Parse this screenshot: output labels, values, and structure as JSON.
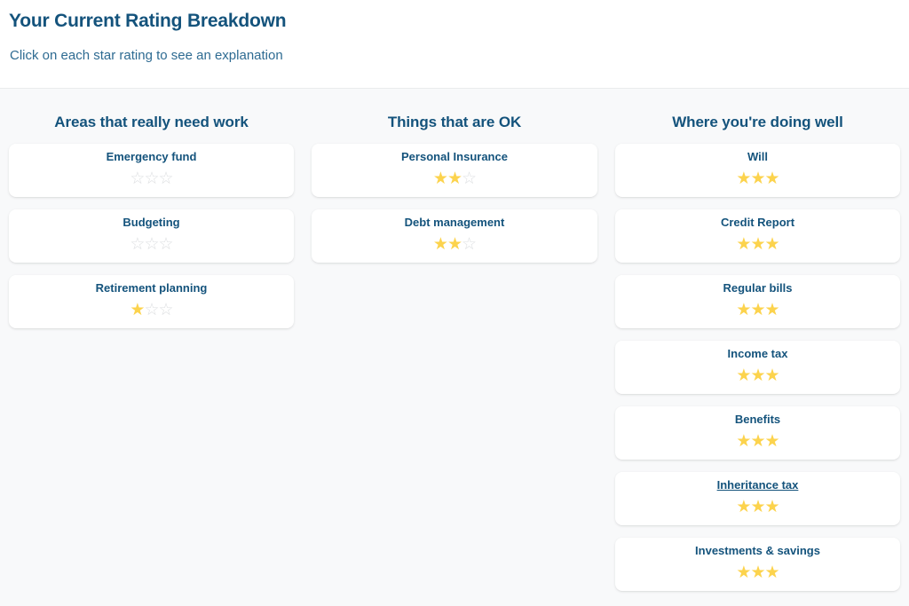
{
  "header": {
    "title": "Your Current Rating Breakdown",
    "subtitle": "Click on each star rating to see an explanation"
  },
  "colors": {
    "heading_blue": "#14537c",
    "subtitle_blue": "#2e6b92",
    "star_filled": "#fcd34d",
    "star_empty": "#dddfe1",
    "page_background": "#f8f9fa",
    "card_background": "#ffffff"
  },
  "icons": {
    "star_filled": "★",
    "star_empty": "☆"
  },
  "max_stars": 3,
  "columns": [
    {
      "heading": "Areas that really need work",
      "items": [
        {
          "label": "Emergency fund",
          "rating": 0,
          "hovered": false
        },
        {
          "label": "Budgeting",
          "rating": 0,
          "hovered": false
        },
        {
          "label": "Retirement planning",
          "rating": 1,
          "hovered": false
        }
      ]
    },
    {
      "heading": "Things that are OK",
      "items": [
        {
          "label": "Personal Insurance",
          "rating": 2,
          "hovered": false
        },
        {
          "label": "Debt management",
          "rating": 2,
          "hovered": false
        }
      ]
    },
    {
      "heading": "Where you're doing well",
      "items": [
        {
          "label": "Will",
          "rating": 3,
          "hovered": false
        },
        {
          "label": "Credit Report",
          "rating": 3,
          "hovered": false
        },
        {
          "label": "Regular bills",
          "rating": 3,
          "hovered": false
        },
        {
          "label": "Income tax",
          "rating": 3,
          "hovered": false
        },
        {
          "label": "Benefits",
          "rating": 3,
          "hovered": false
        },
        {
          "label": "Inheritance tax",
          "rating": 3,
          "hovered": true
        },
        {
          "label": "Investments & savings",
          "rating": 3,
          "hovered": false
        }
      ]
    }
  ]
}
